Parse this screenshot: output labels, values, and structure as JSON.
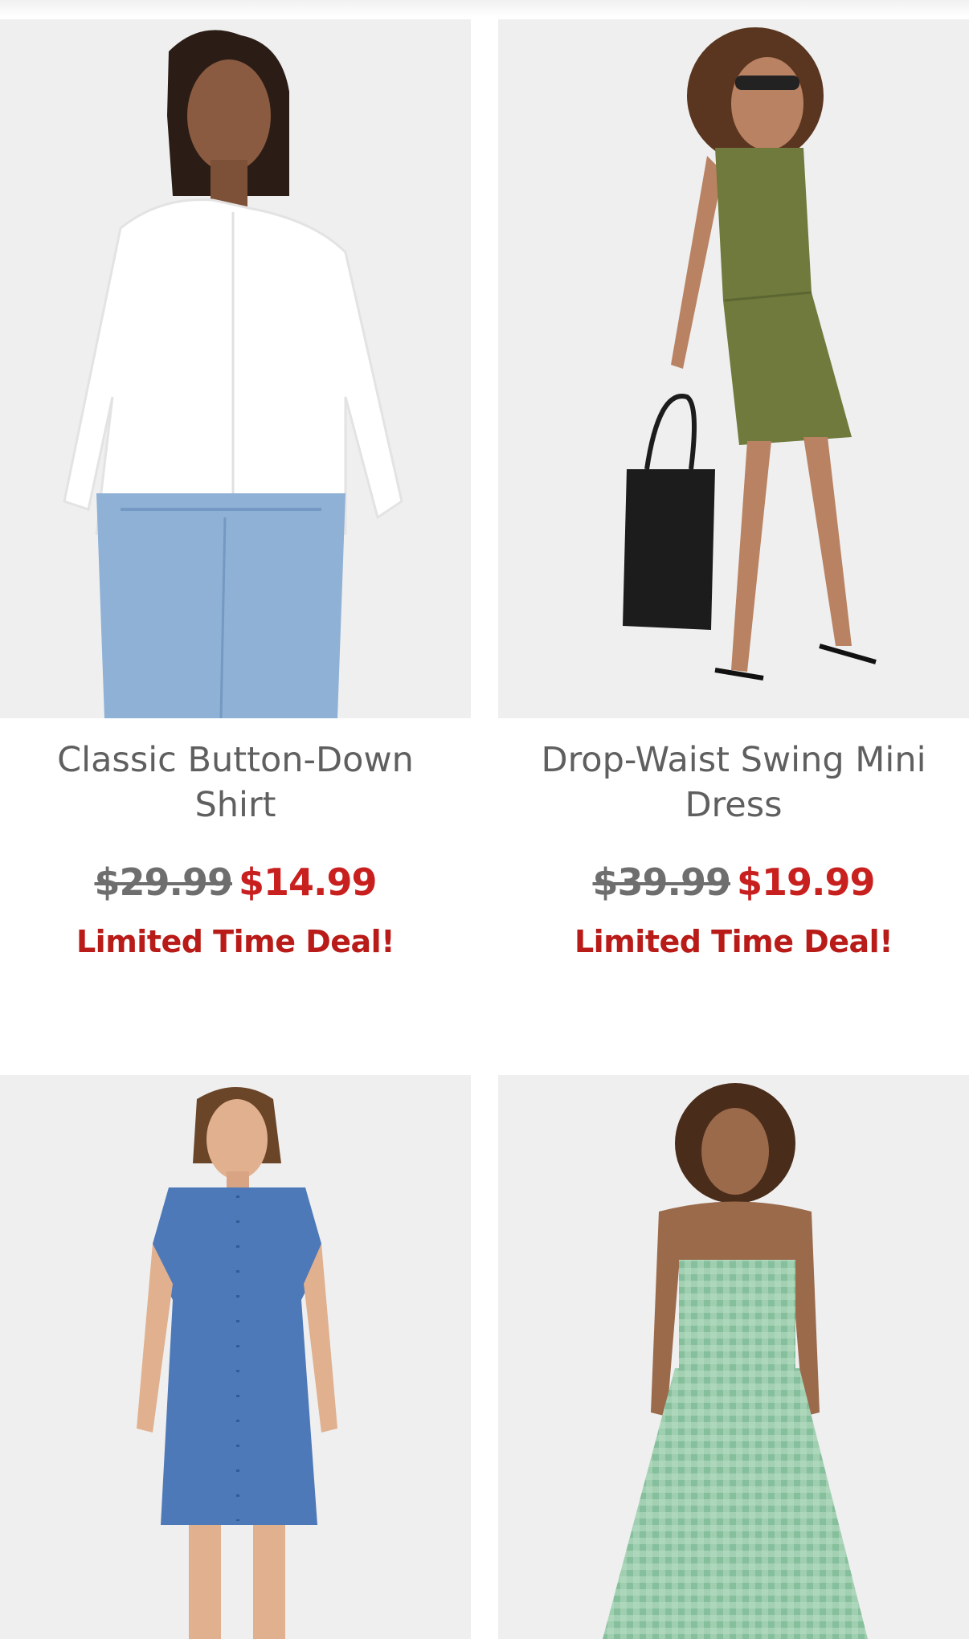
{
  "products": [
    {
      "name": "Classic Button-Down Shirt",
      "was_price": "$29.99",
      "sale_price": "$14.99",
      "deal": "Limited Time Deal!",
      "image_icon": "white-shirt-photo"
    },
    {
      "name": "Drop-Waist Swing Mini Dress",
      "was_price": "$39.99",
      "sale_price": "$19.99",
      "deal": "Limited Time Deal!",
      "image_icon": "green-dress-photo"
    },
    {
      "image_icon": "denim-shirt-dress-photo"
    },
    {
      "image_icon": "gingham-midi-dress-photo"
    }
  ],
  "colors": {
    "product_name": "#5f5f5f",
    "was_price": "#6e6e6e",
    "sale_price": "#c8201f",
    "deal": "#b81b18",
    "photo_bg": "#efefef"
  }
}
